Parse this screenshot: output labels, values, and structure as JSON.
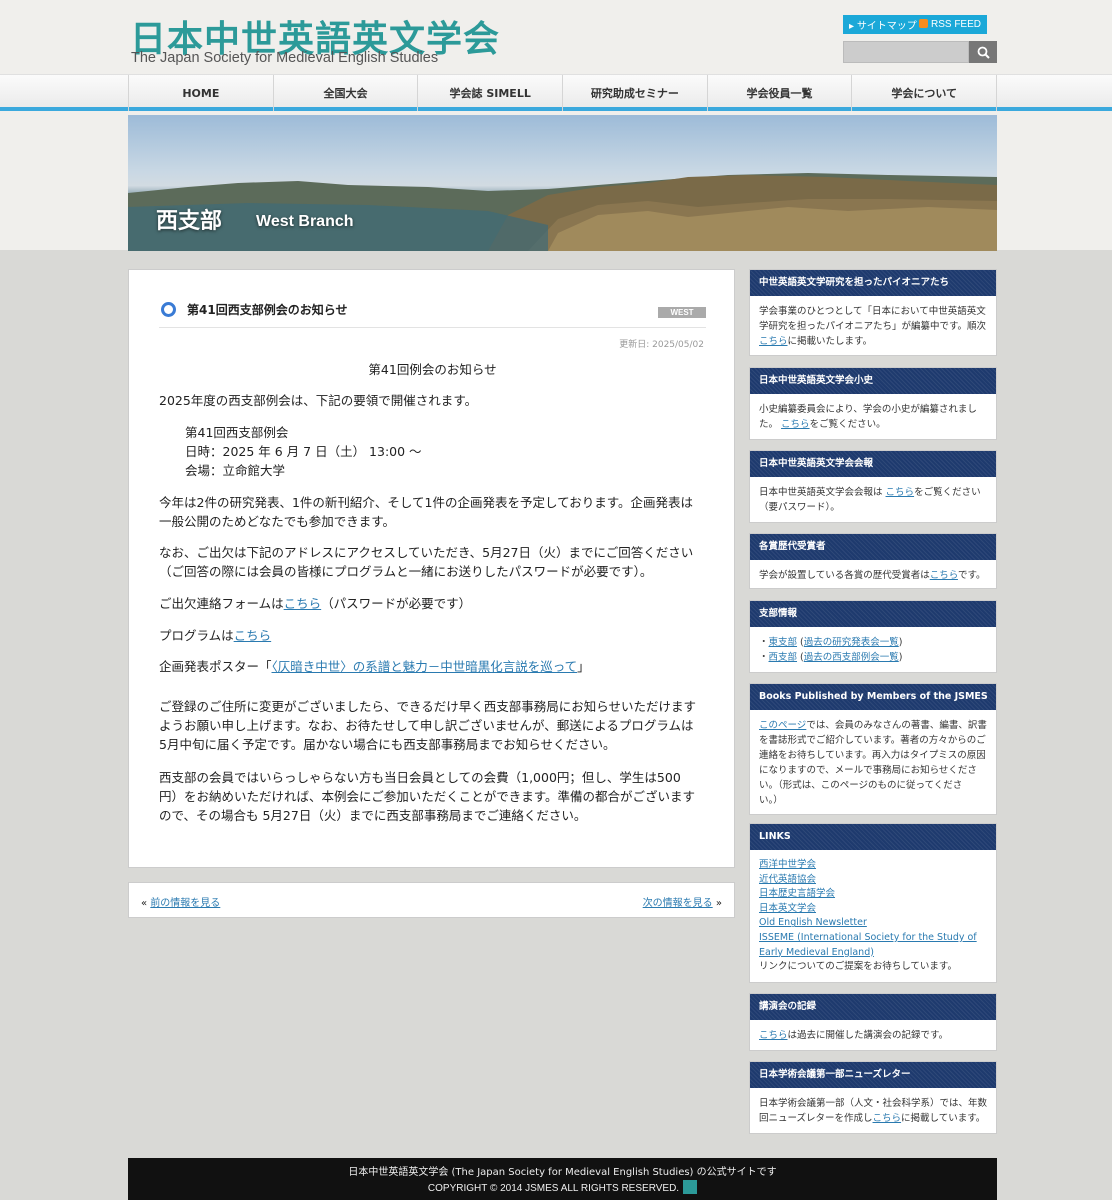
{
  "site": {
    "logo_ja": "日本中世英語英文学会",
    "logo_en": "The Japan Society for Medieval English Studies",
    "sitemap": "サイトマップ",
    "rss": "RSS FEED",
    "search_placeholder": ""
  },
  "nav": [
    "HOME",
    "全国大会",
    "学会誌 SIMELL",
    "研究助成セミナー",
    "学会役員一覧",
    "学会について"
  ],
  "hero": {
    "title_ja": "西支部",
    "title_en": "West Branch"
  },
  "post": {
    "title": "第41回西支部例会のお知らせ",
    "badge": "WEST",
    "updated": "更新日: 2025/05/02",
    "heading": "第41回例会のお知らせ",
    "intro": "2025年度の西支部例会は、下記の要領で開催されます。",
    "event_name": "第41回西支部例会",
    "event_date": "日時：2025 年 6 月 7 日（土） 13:00 ～",
    "event_venue": "会場：立命館大学",
    "p1_line1": "今年は2件の研究発表、1件の新刊紹介、そして1件の企画発表を予定しております。企画発表は",
    "p1_line2": "一般公開のためどなたでも参加できます。",
    "p2_line1": "なお、ご出欠は下記のアドレスにアクセスしていただき、5月27日（火）までにご回答ください",
    "p2_line2": "（ご回答の際には会員の皆様にプログラムと一緒にお送りしたパスワードが必要です）。",
    "form_prefix": "ご出欠連絡フォームは",
    "form_link": "こちら",
    "form_suffix": "（パスワードが必要です）",
    "program_prefix": "プログラムは",
    "program_link": "こちら",
    "poster_prefix": "企画発表ポスター「",
    "poster_link": "〈仄暗き中世〉の系譜と魅力－中世暗黒化言説を巡って",
    "poster_suffix": "」",
    "p3_line1": "ご登録のご住所に変更がございましたら、できるだけ早く西支部事務局にお知らせいただけます",
    "p3_line2": "ようお願い申し上げます。なお、お待たせして申し訳ございませんが、郵送によるプログラムは",
    "p3_line3": "5月中旬に届く予定です。届かない場合にも西支部事務局までお知らせください。",
    "p4_line1": "西支部の会員ではいらっしゃらない方も当日会員としての会費（1,000円；但し、学生は500",
    "p4_line2": "円）をお納めいただければ、本例会にご参加いただくことができます。準備の都合がございます",
    "p4_line3": "ので、その場合も 5月27日（火）までに西支部事務局までご連絡ください。"
  },
  "pager": {
    "prev_mark": "«",
    "prev": "前の情報を見る",
    "next": "次の情報を見る",
    "next_mark": "»"
  },
  "sidebar": {
    "w1": {
      "title": "中世英語英文学研究を担ったパイオニアたち",
      "l1": "学会事業のひとつとして「日本において中世英語英文",
      "l2": "学研究を担ったパイオニアたち」が編纂中です。順次",
      "link": "こちら",
      "l3": "に掲載いたします。"
    },
    "w2": {
      "title": "日本中世英語英文学会小史",
      "l1": "小史編纂委員会により、学会の小史が編纂されまし",
      "l2a": "た。",
      "link": "こちら",
      "l2b": "をご覧ください。"
    },
    "w3": {
      "title": "日本中世英語英文学会会報",
      "l1a": "日本中世英語英文学会会報は",
      "link": "こちら",
      "l1b": "をご覧ください",
      "l2": "（要パスワード）。"
    },
    "w4": {
      "title": "各賞歴代受賞者",
      "l1a": "学会が設置している各賞の歴代受賞者は",
      "link": "こちら",
      "l1b": "です。"
    },
    "w5": {
      "title": "支部情報",
      "east": "東支部",
      "east_sub": "過去の研究発表会一覧",
      "west": "西支部",
      "west_sub": "過去の西支部例会一覧"
    },
    "w6": {
      "title": "Books Published by Members of the JSMES",
      "link": "このページ",
      "l1": "では、会員のみなさんの著書、編書、訳書",
      "l2": "を書誌形式でご紹介しています。著者の方々からのご",
      "l3": "連絡をお待ちしています。再入力はタイプミスの原因",
      "l4": "になりますので、メールで事務局にお知らせくださ",
      "l5": "い。（形式は、このページのものに従ってくださ",
      "l6": "い。）"
    },
    "w7": {
      "title": "LINKS",
      "links": [
        "西洋中世学会",
        "近代英語協会",
        "日本歴史言語学会",
        "日本英文学会",
        "Old English Newsletter",
        "ISSEME (International Society for the Study of",
        "Early Medieval England)"
      ],
      "note": "リンクについてのご提案をお待ちしています。"
    },
    "w8": {
      "title": "講演会の記録",
      "link": "こちら",
      "l1": "は過去に開催した講演会の記録です。"
    },
    "w9": {
      "title": "日本学術会議第一部ニューズレター",
      "l1": "日本学術会議第一部（人文・社会科学系）では、年数",
      "l2a": "回ニューズレターを作成し",
      "link": "こちら",
      "l2b": "に掲載しています。"
    }
  },
  "footer": {
    "line1": "日本中世英語英文学会 (The Japan Society for Medieval English Studies) の公式サイトです",
    "line2": "COPYRIGHT © 2014 JSMES ALL RIGHTS RESERVED."
  },
  "colors": {
    "accent": "#3ba9dd",
    "logo": "#2c9a99",
    "widget_head": "#1e3a6e",
    "link": "#2a7ab0"
  }
}
